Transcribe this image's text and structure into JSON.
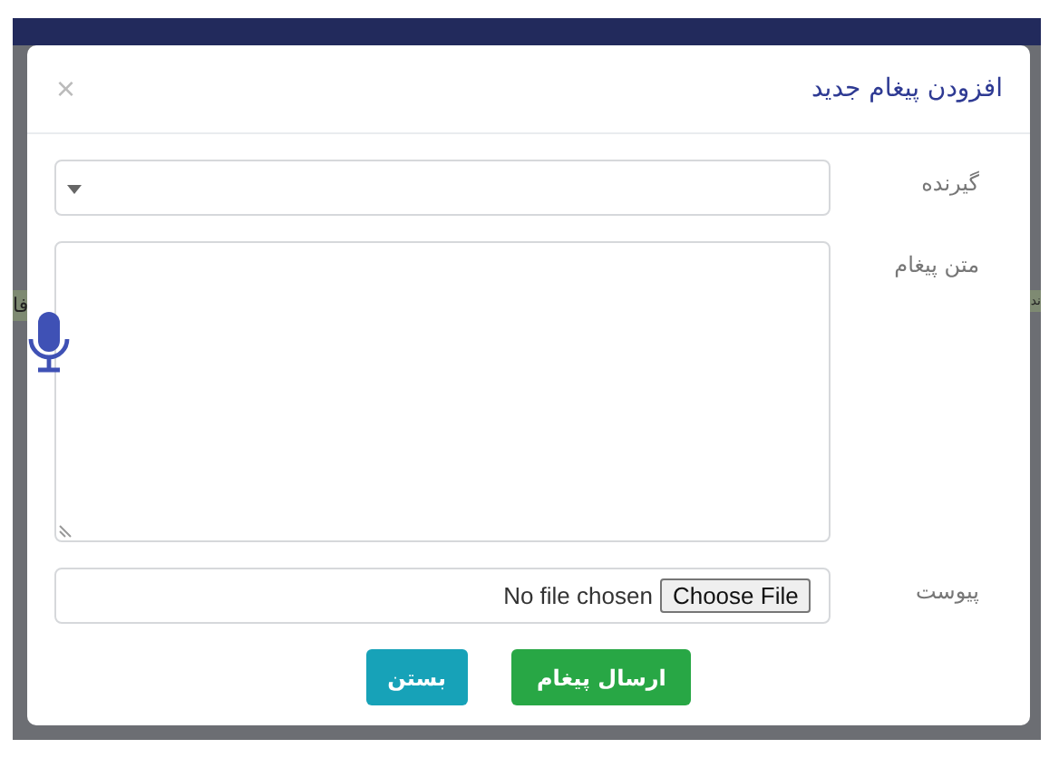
{
  "background": {
    "fragments": [
      "ند",
      "فا"
    ]
  },
  "dialog": {
    "title": "افزودن پیغام جدید",
    "close": "×",
    "fields": [
      {
        "kind": "select",
        "label": "گیرنده"
      },
      {
        "kind": "textarea",
        "label": "متن پیغام"
      },
      {
        "kind": "file",
        "label": "پیوست",
        "button": "Choose File",
        "status": "No file chosen"
      }
    ],
    "buttons": [
      {
        "label": "ارسال پیغام",
        "kind": "primary"
      },
      {
        "label": "بستن",
        "kind": "secondary"
      }
    ]
  }
}
